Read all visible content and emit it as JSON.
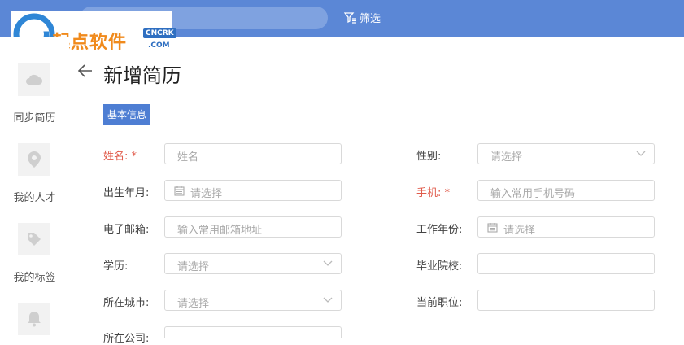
{
  "topbar": {
    "filter_label": "筛选"
  },
  "logo": {
    "text": "起点软件",
    "badge": "CNCRK",
    "sub": ".COM"
  },
  "sidebar": {
    "items": [
      {
        "label": "同步简历",
        "icon": "cloud-icon"
      },
      {
        "label": "我的人才",
        "icon": "location-pin-icon"
      },
      {
        "label": "我的标签",
        "icon": "tag-icon"
      },
      {
        "label": "",
        "icon": "bell-icon"
      }
    ]
  },
  "page": {
    "title": "新增简历",
    "section": "基本信息"
  },
  "form": {
    "name": {
      "label": "姓名:",
      "required_mark": "*",
      "placeholder": "姓名"
    },
    "gender": {
      "label": "性别:",
      "placeholder": "请选择"
    },
    "birth": {
      "label": "出生年月:",
      "placeholder": "请选择"
    },
    "phone": {
      "label": "手机:",
      "required_mark": "*",
      "placeholder": "输入常用手机号码"
    },
    "email": {
      "label": "电子邮箱:",
      "placeholder": "输入常用邮箱地址"
    },
    "work_year": {
      "label": "工作年份:",
      "placeholder": "请选择"
    },
    "education": {
      "label": "学历:",
      "placeholder": "请选择"
    },
    "school": {
      "label": "毕业院校:",
      "placeholder": ""
    },
    "city": {
      "label": "所在城市:",
      "placeholder": "请选择"
    },
    "position": {
      "label": "当前职位:",
      "placeholder": ""
    },
    "company": {
      "label": "所在公司:"
    }
  },
  "colors": {
    "topbar": "#5b87d6",
    "accent": "#4e7ed3",
    "required": "#e05a4a"
  }
}
